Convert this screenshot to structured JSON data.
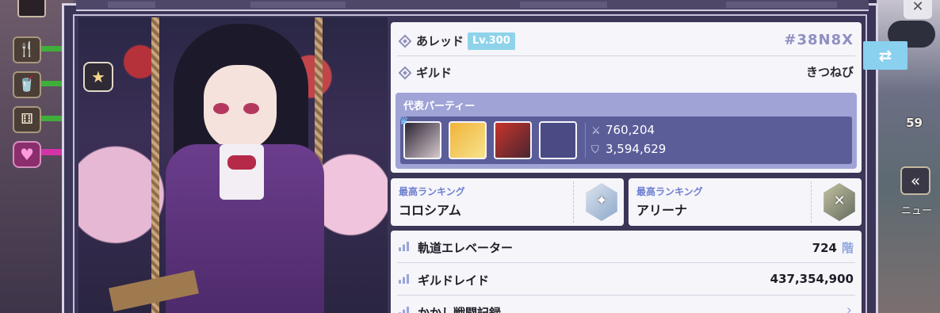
{
  "profile": {
    "player_name": "あレッド",
    "level": "Lv.300",
    "player_id": "#38N8X",
    "guild_label": "ギルド",
    "guild_name": "きつねび"
  },
  "party": {
    "title": "代表パーティー",
    "combat_power": "760,204",
    "defense_power": "3,594,629",
    "members": [
      {
        "icon": "dark-hair-heroine-portrait",
        "leader": true
      },
      {
        "icon": "blonde-heroine-portrait",
        "leader": false
      },
      {
        "icon": "red-hair-heroine-portrait",
        "leader": false
      },
      {
        "icon": "empty-slot",
        "leader": false
      }
    ]
  },
  "rankings": [
    {
      "title": "最高ランキング",
      "mode": "コロシアム",
      "emblem": "colosseum-emblem"
    },
    {
      "title": "最高ランキング",
      "mode": "アリーナ",
      "emblem": "arena-emblem"
    }
  ],
  "records": [
    {
      "label": "軌道エレベーター",
      "value": "724",
      "unit": "階"
    },
    {
      "label": "ギルドレイド",
      "value": "437,354,900",
      "unit": ""
    },
    {
      "label": "かかし戦闘記録",
      "value": "",
      "unit": ""
    }
  ],
  "hud": {
    "timer_fragment": "59",
    "menu_label": "ニュー"
  },
  "colors": {
    "accent_blue": "#8ad0ef",
    "party_bg": "#9fa3d6",
    "rank_title": "#6d7fd0",
    "id_color": "#8f8fc2"
  }
}
